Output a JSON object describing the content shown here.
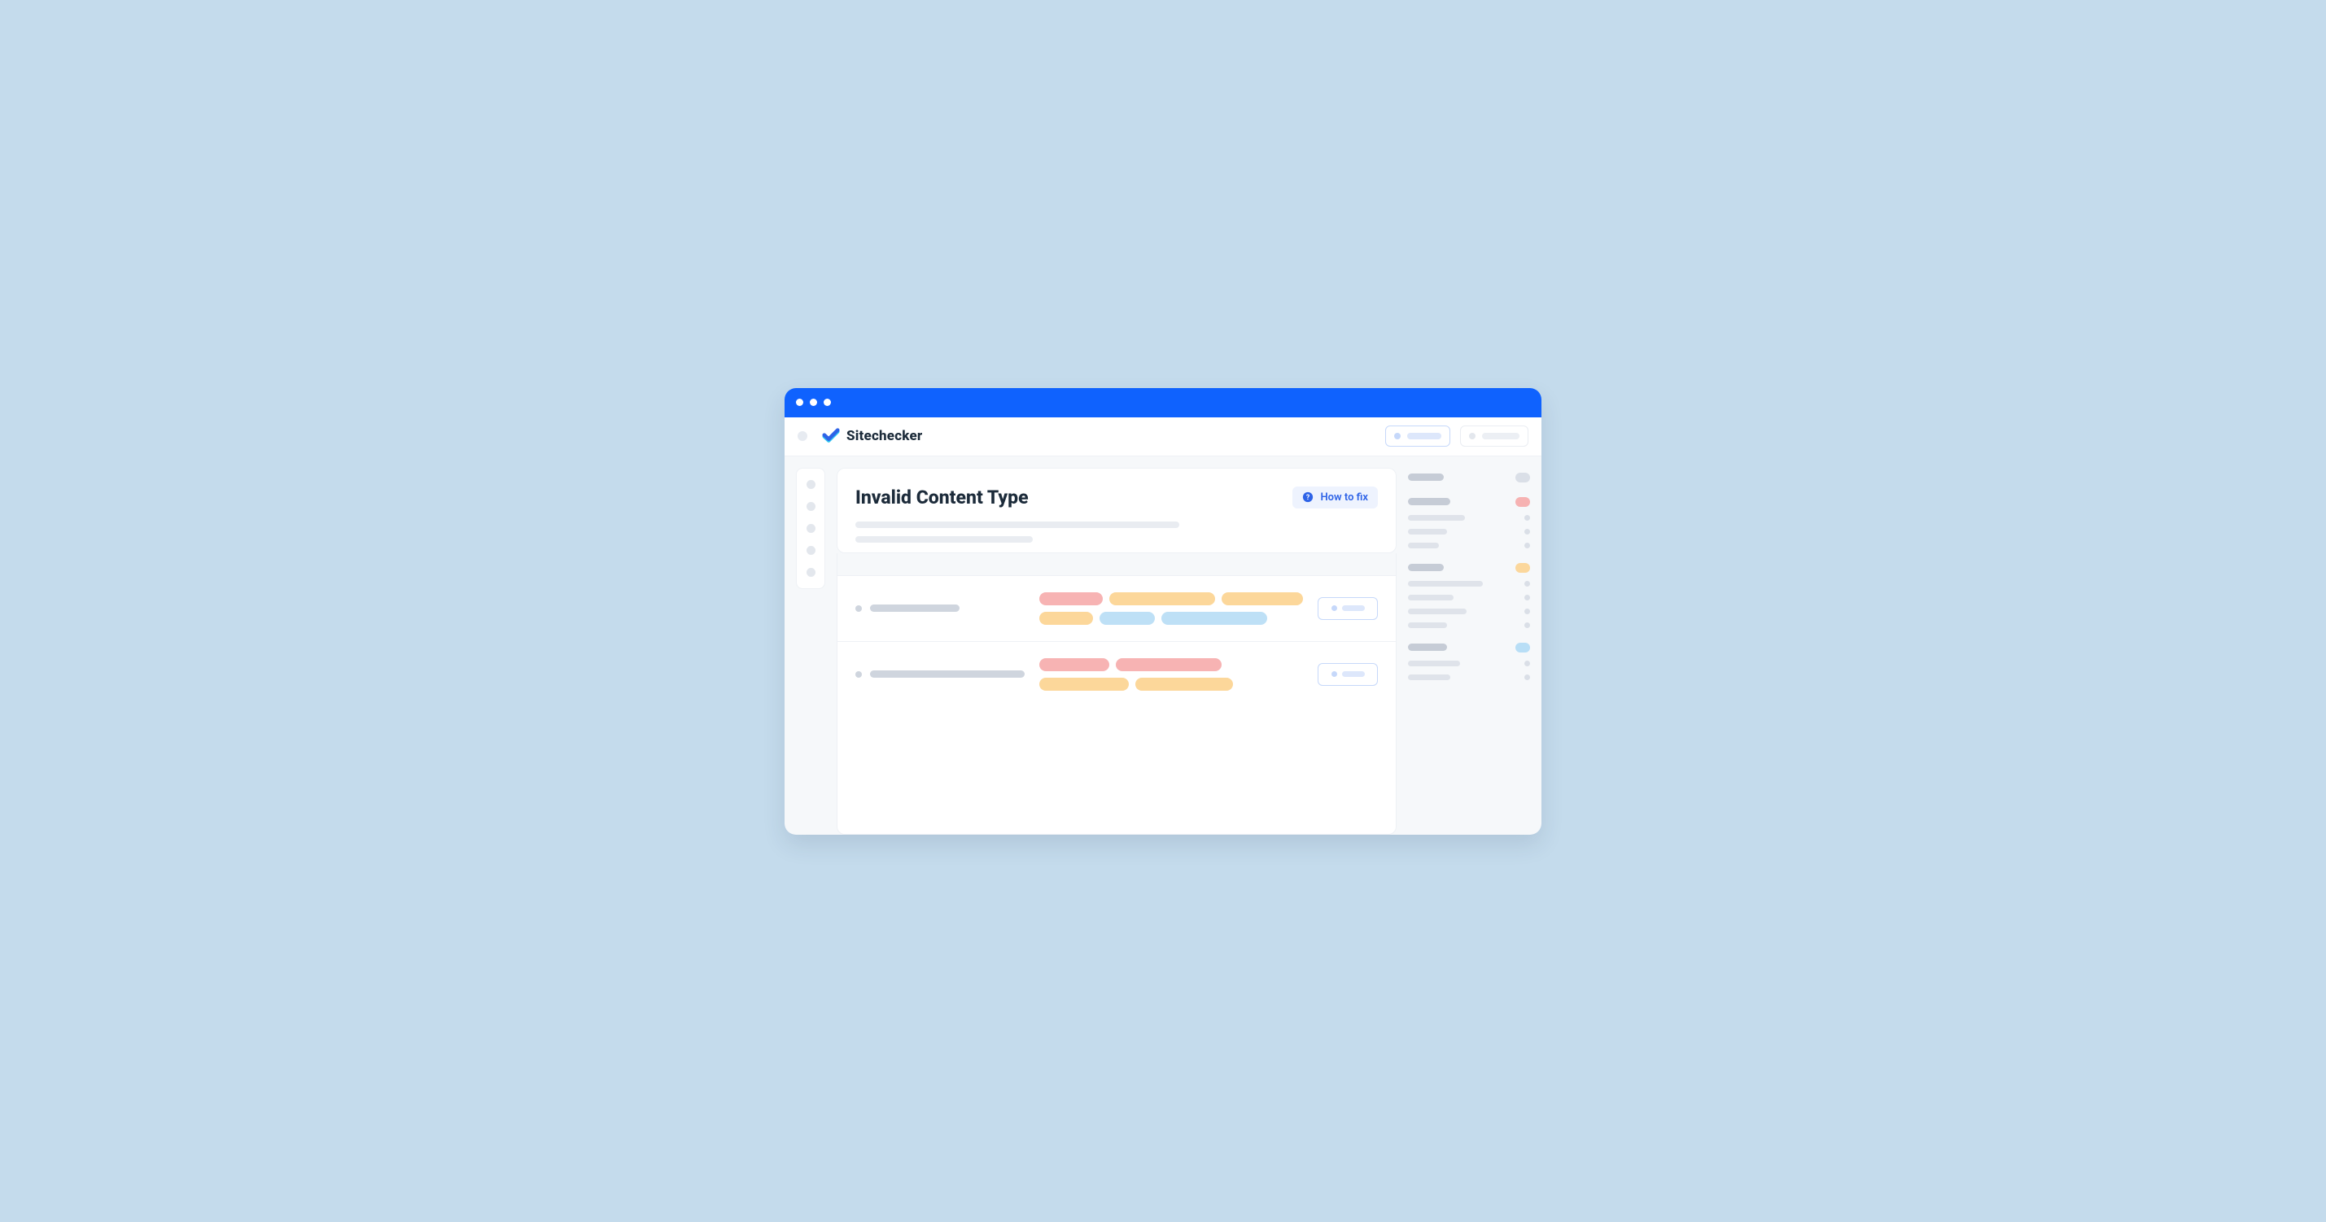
{
  "brand": {
    "name": "Sitechecker"
  },
  "page": {
    "title": "Invalid Content Type",
    "howto_label": "How to fix"
  },
  "colors": {
    "accent": "#0F62FE",
    "red": "#F7B3B3",
    "orange": "#FCD79A",
    "blue": "#BEE0F6"
  },
  "rows": [
    {
      "left_bar_width": 110,
      "tags": [
        {
          "color": "red",
          "w": 78
        },
        {
          "color": "orange",
          "w": 130
        },
        {
          "color": "orange",
          "w": 100
        },
        {
          "color": "orange",
          "w": 66
        },
        {
          "color": "blue",
          "w": 68
        },
        {
          "color": "blue",
          "w": 130
        }
      ]
    },
    {
      "left_bar_width": 190,
      "tags": [
        {
          "color": "red",
          "w": 86
        },
        {
          "color": "red",
          "w": 130
        },
        {
          "color": "orange",
          "w": 110
        },
        {
          "color": "orange",
          "w": 120
        }
      ]
    }
  ],
  "right_groups": [
    {
      "head_w": 44,
      "mark": "grey",
      "lines": []
    },
    {
      "head_w": 52,
      "mark": "red",
      "lines": [
        70,
        48,
        38
      ]
    },
    {
      "head_w": 44,
      "mark": "orange",
      "lines": [
        92,
        56,
        72,
        48
      ]
    },
    {
      "head_w": 48,
      "mark": "blue",
      "lines": [
        64,
        52
      ]
    }
  ]
}
